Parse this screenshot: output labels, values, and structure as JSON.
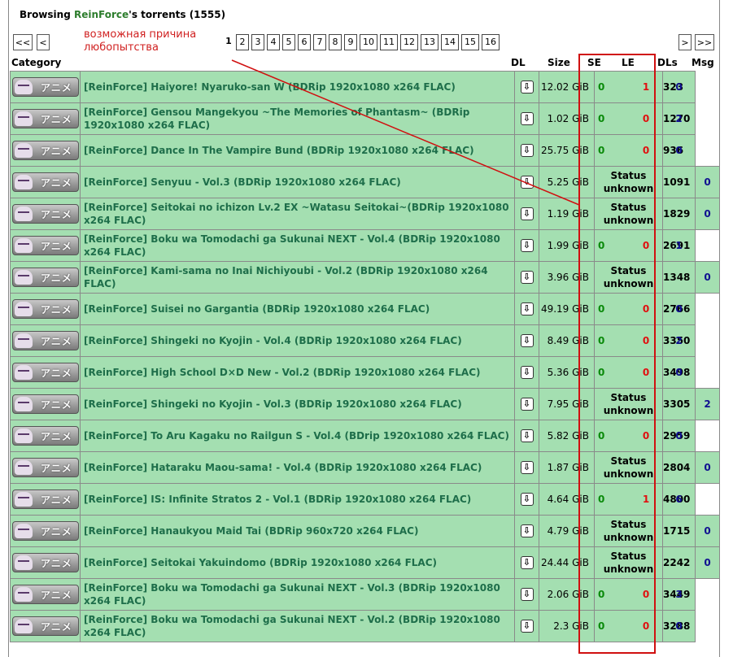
{
  "header": {
    "prefix": "Browsing ",
    "user": "ReinForce",
    "suffix": "'s torrents (1555)"
  },
  "pager": {
    "first": "<<",
    "prev": "<",
    "next": ">",
    "last": ">>",
    "current": "1",
    "pages": [
      "2",
      "3",
      "4",
      "5",
      "6",
      "7",
      "8",
      "9",
      "10",
      "11",
      "12",
      "13",
      "14",
      "15",
      "16"
    ]
  },
  "annotation": {
    "line1": "возможная причина",
    "line2": "любопытства"
  },
  "columns": {
    "category": "Category",
    "dl": "DL",
    "size": "Size",
    "se": "SE",
    "le": "LE",
    "dls": "DLs",
    "msg": "Msg"
  },
  "category_label": "アニメ",
  "dl_glyph": "⇩",
  "status_unknown": "Status unknown",
  "accent_colors": {
    "row_bg": "#a4dfb1",
    "name": "#1e6e4a",
    "seed": "#0a8a0a",
    "leech": "#e01010",
    "highlight": "#d01010"
  },
  "rows": [
    {
      "name": "[ReinForce] Haiyore! Nyaruko-san W (BDRip 1920x1080 x264 FLAC)",
      "size": "12.02 GiB",
      "se": "0",
      "le": "1",
      "status": "",
      "dls": "323",
      "msg": "0"
    },
    {
      "name": "[ReinForce] Gensou Mangekyou ~The Memories of Phantasm~ (BDRip 1920x1080 x264 FLAC)",
      "size": "1.02 GiB",
      "se": "0",
      "le": "0",
      "status": "",
      "dls": "1270",
      "msg": "2"
    },
    {
      "name": "[ReinForce] Dance In The Vampire Bund (BDRip 1920x1080 x264 FLAC)",
      "size": "25.75 GiB",
      "se": "0",
      "le": "0",
      "status": "",
      "dls": "936",
      "msg": "0"
    },
    {
      "name": "[ReinForce] Senyuu - Vol.3 (BDRip 1920x1080 x264 FLAC)",
      "size": "5.25 GiB",
      "se": "",
      "le": "",
      "status": "Status unknown",
      "dls": "1091",
      "msg": "0"
    },
    {
      "name": "[ReinForce] Seitokai no ichizon Lv.2 EX ~Watasu Seitokai~(BDRip 1920x1080 x264 FLAC)",
      "size": "1.19 GiB",
      "se": "",
      "le": "",
      "status": "Status unknown",
      "dls": "1829",
      "msg": "0"
    },
    {
      "name": "[ReinForce] Boku wa Tomodachi ga Sukunai NEXT - Vol.4 (BDRip 1920x1080 x264 FLAC)",
      "size": "1.99 GiB",
      "se": "0",
      "le": "0",
      "status": "",
      "dls": "2691",
      "msg": "1"
    },
    {
      "name": "[ReinForce] Kami-sama no Inai Nichiyoubi - Vol.2 (BDRip 1920x1080 x264 FLAC)",
      "size": "3.96 GiB",
      "se": "",
      "le": "",
      "status": "Status unknown",
      "dls": "1348",
      "msg": "0"
    },
    {
      "name": "[ReinForce] Suisei no Gargantia (BDRip 1920x1080 x264 FLAC)",
      "size": "49.19 GiB",
      "se": "0",
      "le": "0",
      "status": "",
      "dls": "2766",
      "msg": "0"
    },
    {
      "name": "[ReinForce] Shingeki no Kyojin - Vol.4 (BDRip 1920x1080 x264 FLAC)",
      "size": "8.49 GiB",
      "se": "0",
      "le": "0",
      "status": "",
      "dls": "3350",
      "msg": "2"
    },
    {
      "name": "[ReinForce] High School D×D New - Vol.2 (BDRip 1920x1080 x264 FLAC)",
      "size": "5.36 GiB",
      "se": "0",
      "le": "0",
      "status": "",
      "dls": "3498",
      "msg": "0"
    },
    {
      "name": "[ReinForce] Shingeki no Kyojin - Vol.3 (BDRip 1920x1080 x264 FLAC)",
      "size": "7.95 GiB",
      "se": "",
      "le": "",
      "status": "Status unknown",
      "dls": "3305",
      "msg": "2"
    },
    {
      "name": "[ReinForce] To Aru Kagaku no Railgun S - Vol.4 (BDrip 1920x1080 x264 FLAC)",
      "size": "5.82 GiB",
      "se": "0",
      "le": "0",
      "status": "",
      "dls": "2959",
      "msg": "0"
    },
    {
      "name": "[ReinForce] Hataraku Maou-sama! - Vol.4 (BDRip 1920x1080 x264 FLAC)",
      "size": "1.87 GiB",
      "se": "",
      "le": "",
      "status": "Status unknown",
      "dls": "2804",
      "msg": "0"
    },
    {
      "name": "[ReinForce] IS: Infinite Stratos 2 - Vol.1 (BDRip 1920x1080 x264 FLAC)",
      "size": "4.64 GiB",
      "se": "0",
      "le": "1",
      "status": "",
      "dls": "4800",
      "msg": "6"
    },
    {
      "name": "[ReinForce] Hanaukyou Maid Tai (BDRip 960x720 x264 FLAC)",
      "size": "4.79 GiB",
      "se": "",
      "le": "",
      "status": "Status unknown",
      "dls": "1715",
      "msg": "0"
    },
    {
      "name": "[ReinForce] Seitokai Yakuindomo (BDRip 1920x1080 x264 FLAC)",
      "size": "24.44 GiB",
      "se": "",
      "le": "",
      "status": "Status unknown",
      "dls": "2242",
      "msg": "0"
    },
    {
      "name": "[ReinForce] Boku wa Tomodachi ga Sukunai NEXT - Vol.3 (BDRip 1920x1080 x264 FLAC)",
      "size": "2.06 GiB",
      "se": "0",
      "le": "0",
      "status": "",
      "dls": "3449",
      "msg": "3"
    },
    {
      "name": "[ReinForce] Boku wa Tomodachi ga Sukunai NEXT - Vol.2 (BDRip 1920x1080 x264 FLAC)",
      "size": "2.3 GiB",
      "se": "0",
      "le": "0",
      "status": "",
      "dls": "3288",
      "msg": "0"
    }
  ]
}
